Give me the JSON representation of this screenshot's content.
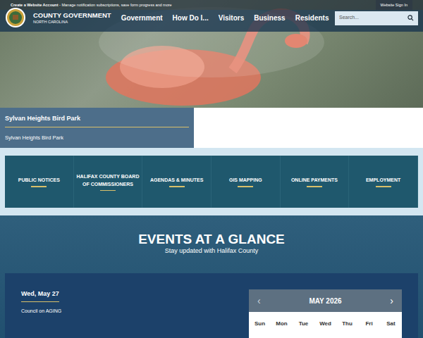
{
  "top_bar": {
    "account_link": "Create a Website Account",
    "account_text": " - Manage notification subscriptions, save form progress and more",
    "sign_in": "Website Sign In"
  },
  "header": {
    "logo_title": "COUNTY GOVERNMENT",
    "logo_subtitle": "NORTH CAROLINA",
    "nav": [
      "Government",
      "How Do I...",
      "Visitors",
      "Business",
      "Residents"
    ],
    "search": {
      "placeholder": "Search..."
    }
  },
  "hero": {
    "caption_title": "Sylvan Heights Bird Park",
    "caption_text": "Sylvan Heights Bird Park"
  },
  "quick_links": [
    "PUBLIC NOTICES",
    "HALIFAX COUNTY BOARD OF COMMISSIONERS",
    "AGENDAS & MINUTES",
    "GIS MAPPING",
    "ONLINE PAYMENTS",
    "EMPLOYMENT"
  ],
  "events": {
    "heading": "EVENTS AT A GLANCE",
    "subheading": "Stay updated with Halifax County",
    "items": [
      {
        "date": "Wed, May 27",
        "title": "Council on AGING"
      }
    ],
    "calendar": {
      "month": "MAY 2026",
      "prev": "‹",
      "next": "›",
      "weekdays": [
        "Sun",
        "Mon",
        "Tue",
        "Wed",
        "Thu",
        "Fri",
        "Sat"
      ]
    }
  }
}
